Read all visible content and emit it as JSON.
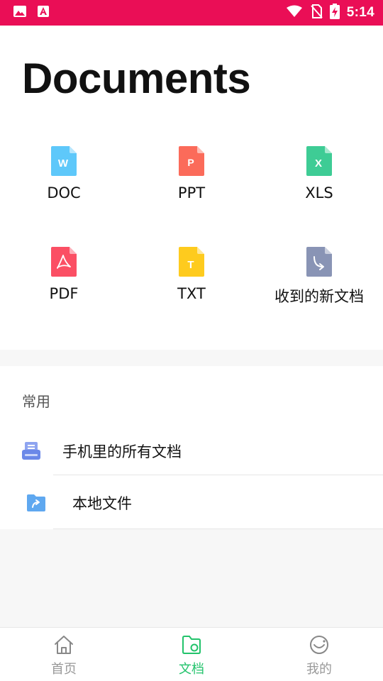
{
  "status_bar": {
    "time": "5:14",
    "icons": [
      "image-notification-icon",
      "font-app-icon",
      "wifi-icon",
      "no-sim-icon",
      "battery-charging-icon"
    ]
  },
  "page": {
    "title": "Documents"
  },
  "doc_types": [
    {
      "label": "DOC",
      "letter": "W",
      "color": "#5ec8fa",
      "icon": "doc-file-icon"
    },
    {
      "label": "PPT",
      "letter": "P",
      "color": "#fb6b5a",
      "icon": "ppt-file-icon"
    },
    {
      "label": "XLS",
      "letter": "X",
      "color": "#3ecc95",
      "icon": "xls-file-icon"
    },
    {
      "label": "PDF",
      "letter": "",
      "color": "#fb4f64",
      "icon": "pdf-file-icon"
    },
    {
      "label": "TXT",
      "letter": "T",
      "color": "#fecb1e",
      "icon": "txt-file-icon"
    },
    {
      "label": "收到的新文档",
      "letter": "",
      "color": "#8994b5",
      "icon": "received-file-icon"
    }
  ],
  "common": {
    "title": "常用",
    "items": [
      {
        "label": "手机里的所有文档",
        "icon": "phone-documents-icon",
        "color": "#6b88e8"
      },
      {
        "label": "本地文件",
        "icon": "local-folder-icon",
        "color": "#5fa8f0"
      }
    ]
  },
  "bottom_nav": {
    "items": [
      {
        "label": "首页",
        "icon": "home-icon",
        "active": false
      },
      {
        "label": "文档",
        "icon": "documents-folder-icon",
        "active": true
      },
      {
        "label": "我的",
        "icon": "profile-smile-icon",
        "active": false
      }
    ],
    "active_color": "#22c36b",
    "inactive_color": "#999999"
  },
  "colors": {
    "status_bar": "#ea0e56",
    "background": "#f7f7f7"
  }
}
